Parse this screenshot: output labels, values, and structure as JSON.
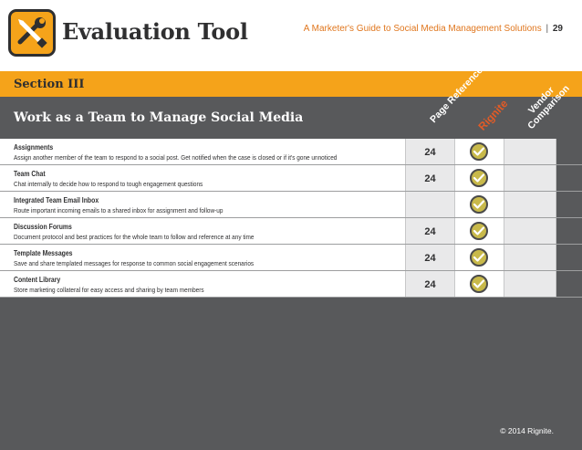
{
  "header": {
    "title": "Evaluation Tool",
    "guide_text": "A Marketer's Guide to Social Media Management Solutions",
    "separator": "|",
    "page_number": "29",
    "logo_icon": "wrench-screwdriver-icon",
    "colors": {
      "accent": "#f5a31a",
      "dark": "#2f2f30",
      "guide_text": "#e0761d",
      "background": "#58595b"
    }
  },
  "section": {
    "label": "Section III"
  },
  "heading": {
    "label": "Work as a Team to Manage Social Media"
  },
  "columns": {
    "page_reference": "Page Reference",
    "rignite": "Rignite",
    "vendor_line1": "Vendor",
    "vendor_line2": "Comparison"
  },
  "rows": [
    {
      "name": "Assignments",
      "description": "Assign another member of the team to respond to a social post. Get notified when the case is closed or if it's gone unnoticed",
      "page": "24",
      "rignite_check": "check-icon"
    },
    {
      "name": "Team Chat",
      "description": "Chat internally to decide how to respond to tough engagement questions",
      "page": "24",
      "rignite_check": "check-icon"
    },
    {
      "name": "Integrated Team Email Inbox",
      "description": "Route important incoming emails to a shared inbox for assignment and follow-up",
      "page": "",
      "rignite_check": "check-icon"
    },
    {
      "name": "Discussion Forums",
      "description": "Document protocol and best practices for the whole team to follow and reference at any time",
      "page": "24",
      "rignite_check": "check-icon"
    },
    {
      "name": "Template Messages",
      "description": "Save and share templated messages for response to common social engagement scenarios",
      "page": "24",
      "rignite_check": "check-icon"
    },
    {
      "name": "Content Library",
      "description": "Store marketing collateral for easy access and sharing by team members",
      "page": "24",
      "rignite_check": "check-icon"
    }
  ],
  "footer": {
    "copyright": "© 2014 Rignite."
  }
}
